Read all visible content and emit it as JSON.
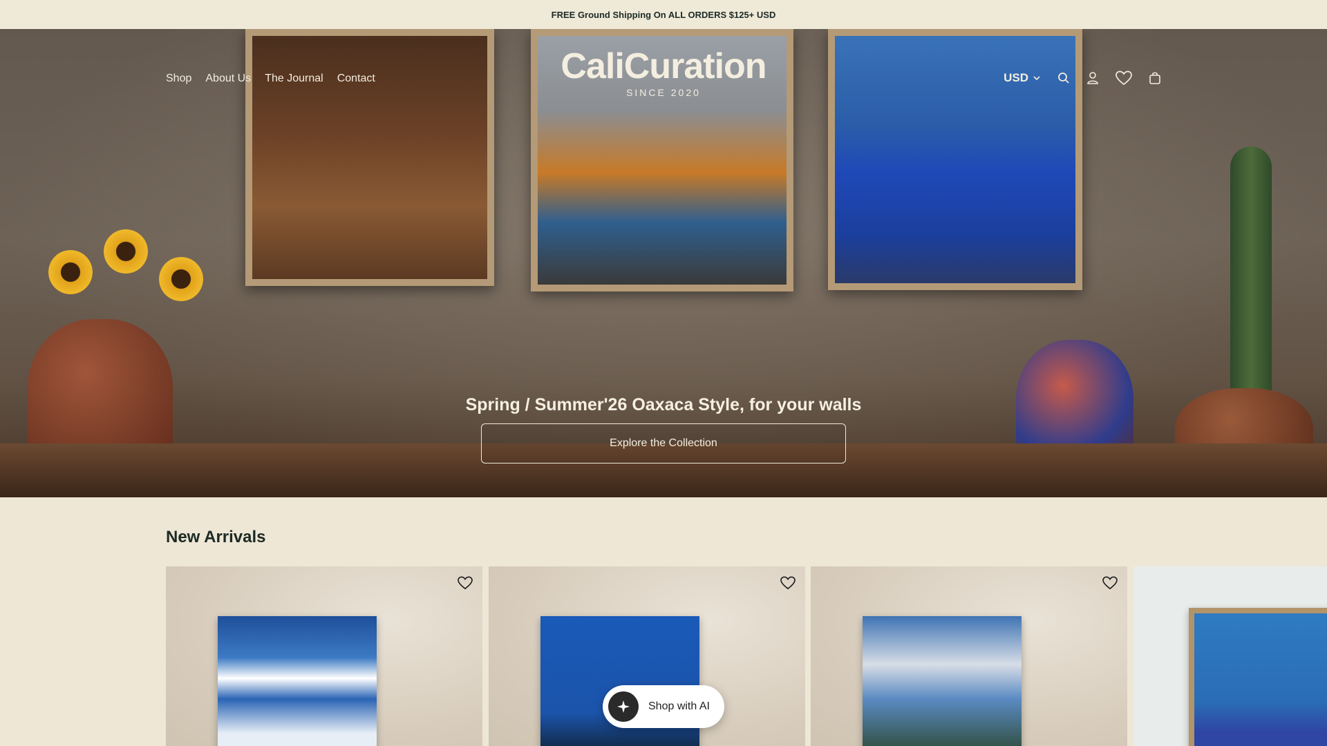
{
  "announcement": {
    "text": "FREE Ground Shipping On ALL ORDERS $125+ USD"
  },
  "nav": {
    "items": [
      "Shop",
      "About Us",
      "The Journal",
      "Contact"
    ]
  },
  "logo": {
    "name": "CaliCuration",
    "tagline": "SINCE 2020"
  },
  "header_tools": {
    "currency": "USD",
    "icons": [
      "search-icon",
      "account-icon",
      "wishlist-icon",
      "cart-icon"
    ]
  },
  "hero": {
    "headline": "Spring / Summer'26 Oaxaca Style, for your walls",
    "cta_label": "Explore the Collection"
  },
  "new_arrivals": {
    "title": "New Arrivals",
    "cards": 4
  },
  "ai_assistant": {
    "label": "Shop with AI"
  },
  "colors": {
    "background": "#eee7d6",
    "text": "#1c2a24",
    "hero_text": "#f4eee0"
  }
}
